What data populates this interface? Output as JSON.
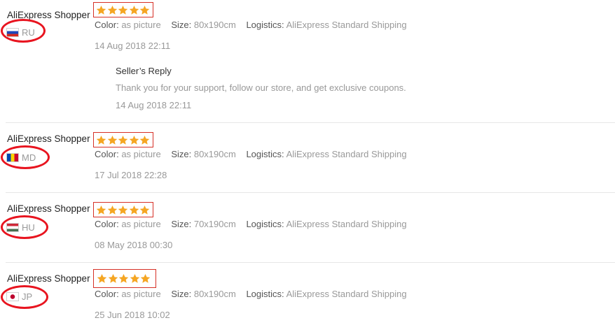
{
  "reviews": [
    {
      "buyer": "AliExpress Shopper",
      "country_code": "RU",
      "rating_stars": 5,
      "color_label": "Color:",
      "color_value": "as picture",
      "size_label": "Size:",
      "size_value": "80x190cm",
      "logistics_label": "Logistics:",
      "logistics_value": "AliExpress Standard Shipping",
      "date": "14 Aug 2018 22:11",
      "reply": {
        "title": "Seller’s Reply",
        "text": "Thank you for your support, follow our store, and get exclusive coupons.",
        "date": "14 Aug 2018 22:11"
      }
    },
    {
      "buyer": "AliExpress Shopper",
      "country_code": "MD",
      "rating_stars": 5,
      "color_label": "Color:",
      "color_value": "as picture",
      "size_label": "Size:",
      "size_value": "80x190cm",
      "logistics_label": "Logistics:",
      "logistics_value": "AliExpress Standard Shipping",
      "date": "17 Jul 2018 22:28"
    },
    {
      "buyer": "AliExpress Shopper",
      "country_code": "HU",
      "rating_stars": 5,
      "color_label": "Color:",
      "color_value": "as picture",
      "size_label": "Size:",
      "size_value": "70x190cm",
      "logistics_label": "Logistics:",
      "logistics_value": "AliExpress Standard Shipping",
      "date": "08 May 2018 00:30"
    },
    {
      "buyer": "AliExpress Shopper",
      "country_code": "JP",
      "rating_stars": 5,
      "color_label": "Color:",
      "color_value": "as picture",
      "size_label": "Size:",
      "size_value": "80x190cm",
      "logistics_label": "Logistics:",
      "logistics_value": "AliExpress Standard Shipping",
      "date": "25 Jun 2018 10:02"
    }
  ],
  "colors": {
    "star": "#f5a623",
    "annotation_red": "#e8141f",
    "muted_text": "#999999"
  }
}
